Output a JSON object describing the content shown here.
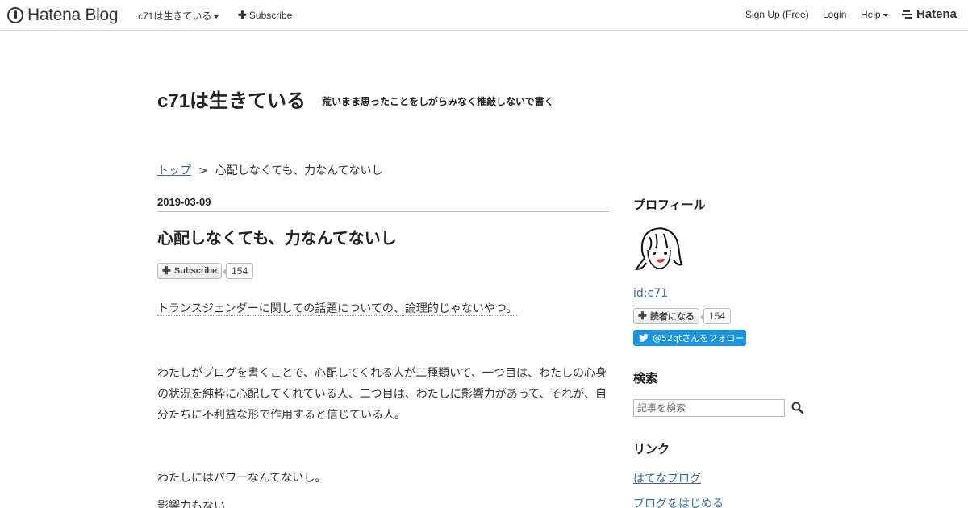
{
  "header": {
    "logo_text": "Hatena Blog",
    "blog_menu": "c71は生きている",
    "subscribe": "Subscribe",
    "signup": "Sign Up (Free)",
    "login": "Login",
    "help": "Help",
    "hatena": "Hatena"
  },
  "blog": {
    "title": "c71は生きている",
    "description": "荒いまま思ったことをしがらみなく推敲しないで書く"
  },
  "breadcrumb": {
    "top": "トップ",
    "separator": ">",
    "current": "心配しなくても、力なんてないし"
  },
  "entry": {
    "date": "2019-03-09",
    "title": "心配しなくても、力なんてないし",
    "subscribe_label": "Subscribe",
    "subscribe_count": "154",
    "paragraphs": [
      "トランスジェンダーに関しての話題についての、論理的じゃないやつ。",
      "わたしがブログを書くことで、心配してくれる人が二種類いて、一つ目は、わたしの心身の状況を純粋に心配してくれている人、二つ目は、わたしに影響力があって、それが、自分たちに不利益な形で作用すると信じている人。",
      "わたしにはパワーなんてないし。",
      "影響力もない"
    ]
  },
  "sidebar": {
    "profile_heading": "プロフィール",
    "user_id": "id:c71",
    "reader_label": "読者になる",
    "reader_count": "154",
    "twitter_follow": "@52qtさんをフォロー",
    "search_heading": "検索",
    "search_placeholder": "記事を検索",
    "links_heading": "リンク",
    "links": [
      "はてなブログ",
      "ブログをはじめる"
    ]
  }
}
